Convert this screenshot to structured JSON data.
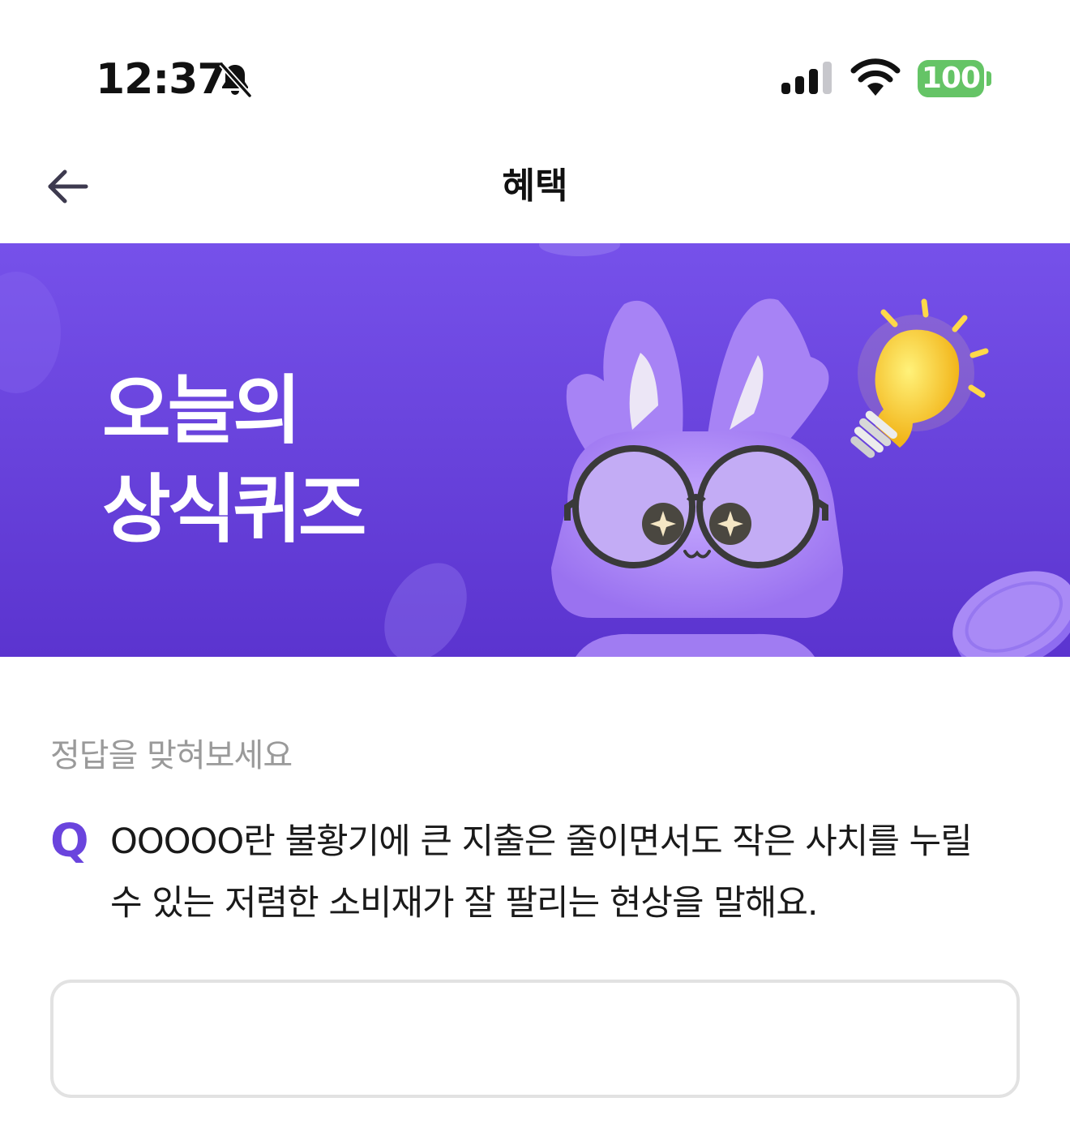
{
  "status_bar": {
    "time": "12:37",
    "battery_level": "100",
    "icons": [
      "bell-slash-icon",
      "cellular-signal-icon",
      "wifi-icon",
      "battery-icon"
    ],
    "battery_color": "#65c466"
  },
  "nav": {
    "back_icon": "arrow-left-icon",
    "title": "혜택"
  },
  "banner": {
    "title_line1": "오늘의",
    "title_line2": "상식퀴즈",
    "background_color": "#6a44dd",
    "illustration": "purple-rabbit-with-glasses-and-lightbulb"
  },
  "quiz": {
    "hint": "정답을 맞혀보세요",
    "q_label": "Q",
    "question": "OOOOO란 불황기에 큰 지출은 줄이면서도 작은 사치를 누릴 수 있는 저렴한 소비재가 잘 팔리는 현상을 말해요.",
    "answer_value": "",
    "accent_color": "#6a44dd"
  }
}
